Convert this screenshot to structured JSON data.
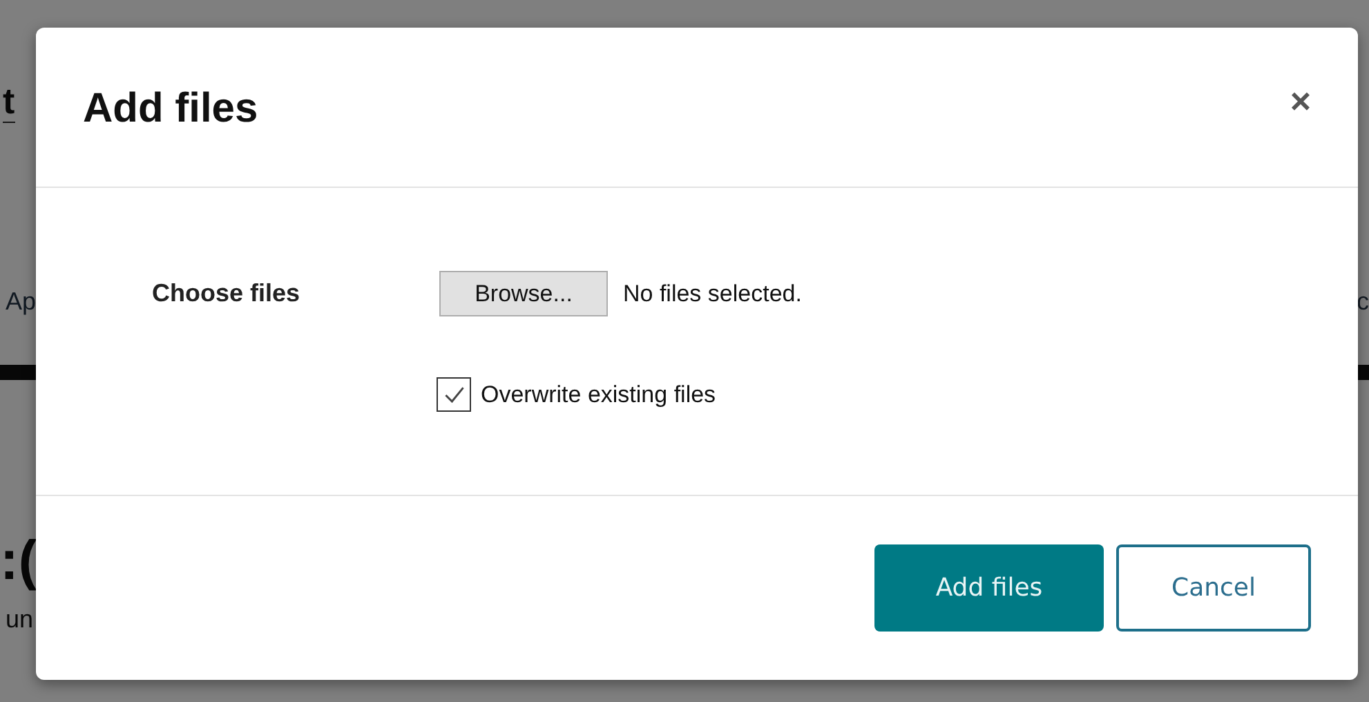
{
  "background_page": {
    "heading_fragment": "t",
    "tab_fragment_left": "Ap",
    "tab_fragment_right": "c",
    "title_fragment": ":(",
    "text_fragment": "un"
  },
  "dialog": {
    "title": "Add files",
    "close": "×",
    "file_field": {
      "label": "Choose files",
      "button": "Browse...",
      "status": "No files selected."
    },
    "overwrite": {
      "label": "Overwrite existing files",
      "checked": true
    },
    "buttons": [
      {
        "label": "Add files",
        "kind": "primary"
      },
      {
        "label": "Cancel",
        "kind": "secondary"
      }
    ]
  }
}
